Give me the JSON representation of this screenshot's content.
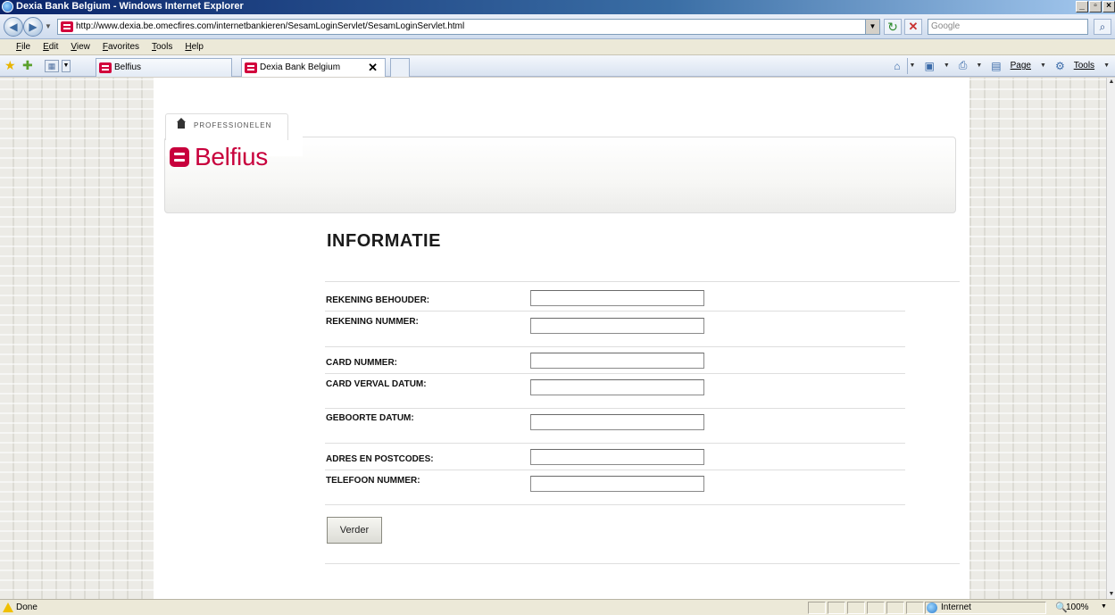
{
  "window": {
    "title": "Dexia Bank Belgium - Windows Internet Explorer"
  },
  "address": {
    "url": "http://www.dexia.be.omecfires.com/internetbankieren/SesamLoginServlet/SesamLoginServlet.html",
    "search_placeholder": "Google"
  },
  "menu": [
    "File",
    "Edit",
    "View",
    "Favorites",
    "Tools",
    "Help"
  ],
  "tabs": [
    {
      "label": "Belfius"
    },
    {
      "label": "Dexia Bank Belgium",
      "close": "✕"
    }
  ],
  "commandbar": {
    "page": "Page",
    "tools": "Tools"
  },
  "site": {
    "top_tab": "PROFESSIONELEN",
    "logo_text": "Belfius",
    "form_title": "INFORMATIE",
    "fields": [
      {
        "label": "REKENING BEHOUDER:",
        "value": ""
      },
      {
        "label": "REKENING NUMMER:",
        "value": ""
      },
      {
        "label": "CARD NUMMER:",
        "value": ""
      },
      {
        "label": "CARD VERVAL DATUM:",
        "value": ""
      },
      {
        "label": "GEBOORTE DATUM:",
        "value": ""
      },
      {
        "label": "ADRES EN POSTCODES:",
        "value": ""
      },
      {
        "label": "TELEFOON NUMMER:",
        "value": ""
      }
    ],
    "submit_label": "Verder"
  },
  "status": {
    "text": "Done",
    "zone": "Internet",
    "zoom": "100%"
  }
}
